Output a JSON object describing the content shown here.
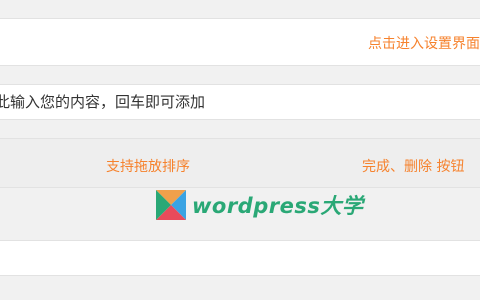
{
  "header": {
    "settings_link": "点击进入设置界面"
  },
  "todo": {
    "placeholder": "在此输入您的内容，回车即可添加"
  },
  "hints": {
    "drag": "支持拖放排序",
    "actions": "完成、删除 按钮"
  },
  "watermark": {
    "text": "wordpress大学",
    "text_color": "#2aa876",
    "logo_icon": "wordpress-daxue-logo-icon"
  },
  "colors": {
    "accent": "#f6822d",
    "background": "#f1f1f1",
    "panel": "#ffffff"
  }
}
